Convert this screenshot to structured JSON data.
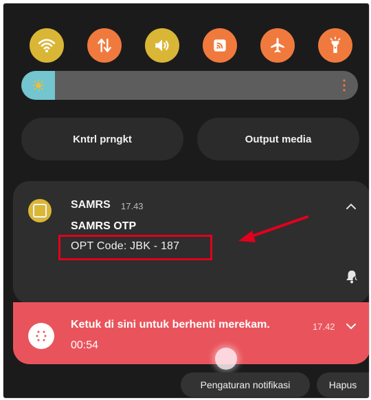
{
  "colors": {
    "yellow": "#d9b636",
    "orange": "#f07a3e",
    "notif_bg": "#2e2e2e",
    "record_bg": "#e9545c",
    "highlight": "#e3001b",
    "slider_fill": "#73c5cf",
    "sun": "#e6c13a"
  },
  "quick_settings": [
    {
      "name": "wifi",
      "icon": "wifi-icon",
      "active_color": "yellow"
    },
    {
      "name": "mobile-data",
      "icon": "data-transfer-icon",
      "active_color": "orange"
    },
    {
      "name": "sound",
      "icon": "volume-icon",
      "active_color": "yellow"
    },
    {
      "name": "cast",
      "icon": "cast-icon",
      "active_color": "orange"
    },
    {
      "name": "airplane-mode",
      "icon": "airplane-icon",
      "active_color": "orange"
    },
    {
      "name": "flashlight",
      "icon": "flashlight-icon",
      "active_color": "orange"
    }
  ],
  "brightness": {
    "level_percent": 10,
    "icon": "sun-icon"
  },
  "pills": {
    "device_control": "Kntrl prngkt",
    "media_output": "Output media"
  },
  "notification": {
    "app_name": "SAMRS",
    "time": "17.43",
    "title": "SAMRS OTP",
    "body": "OPT Code: JBK - 187"
  },
  "recording": {
    "text": "Ketuk di sini untuk berhenti merekam.",
    "time": "17.42",
    "timer": "00:54"
  },
  "footer": {
    "settings": "Pengaturan notifikasi",
    "clear": "Hapus"
  }
}
